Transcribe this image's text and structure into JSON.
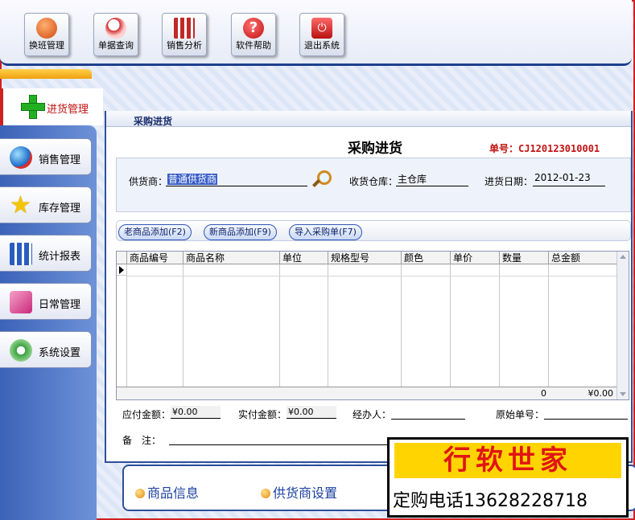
{
  "toolbar": {
    "buttons": [
      {
        "label": "换班管理",
        "icon": "users-icon",
        "color": "#e05a10"
      },
      {
        "label": "单据查询",
        "icon": "search-icon",
        "color": "#d03030"
      },
      {
        "label": "销售分析",
        "icon": "bar-chart-icon",
        "color": "#c02828"
      },
      {
        "label": "软件帮助",
        "icon": "help-icon",
        "color": "#d01818"
      },
      {
        "label": "退出系统",
        "icon": "power-icon",
        "color": "#c01818"
      }
    ]
  },
  "nav": {
    "active_label": "进货管理",
    "items": [
      {
        "label": "销售管理",
        "icon": "globe-icon",
        "color": "#2a8ad8"
      },
      {
        "label": "库存管理",
        "icon": "star-icon",
        "color": "#f5c400"
      },
      {
        "label": "统计报表",
        "icon": "report-icon",
        "color": "#2a5cc0"
      },
      {
        "label": "日常管理",
        "icon": "tools-icon",
        "color": "#d83a8a"
      },
      {
        "label": "系统设置",
        "icon": "gear-icon",
        "color": "#3aa040"
      }
    ]
  },
  "window": {
    "title": "采购进货",
    "form_title": "采购进货",
    "order_no": "单号：CJ120123010001",
    "supplier_label": "供货商：",
    "supplier_value": "普通供货商",
    "warehouse_label": "收货仓库：",
    "warehouse_value": "主仓库",
    "date_label": "进货日期：",
    "date_value": "2012-01-23"
  },
  "actions": {
    "add_old": "老商品添加(F2)",
    "add_new": "新商品添加(F9)",
    "import_order": "导入采购单(F7)"
  },
  "grid": {
    "columns": [
      "商品编号",
      "商品名称",
      "单位",
      "规格型号",
      "颜色",
      "单价",
      "数量",
      "总金额"
    ],
    "footer_qty": "0",
    "footer_total": "¥0.00"
  },
  "totals": {
    "payable_label": "应付金额：",
    "payable_value": "¥0.00",
    "paid_label": "实付金额：",
    "paid_value": "¥0.00",
    "handler_label": "经办人：",
    "original_no_label": "原始单号：",
    "note_label": "备　注："
  },
  "quick_links": {
    "product_info": "商品信息",
    "supplier_settings": "供货商设置"
  },
  "ad": {
    "brand": "行软世家",
    "phone": "定购电话13628228718"
  }
}
